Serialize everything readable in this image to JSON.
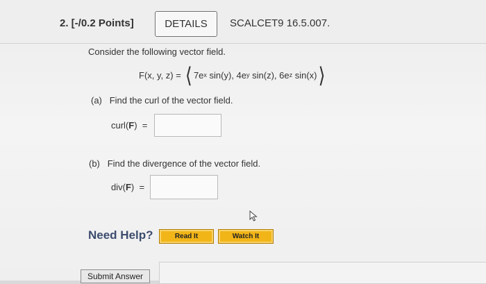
{
  "question": {
    "number_points": "2.  [-/0.2 Points]",
    "details_label": "DETAILS",
    "course_code": "SCALCET9 16.5.007."
  },
  "problem": {
    "intro": "Consider the following vector field.",
    "formula": {
      "lhs": "F(x, y, z) =",
      "c1_coef": "7e",
      "c1_exp": "x",
      "c1_rest": " sin(y), ",
      "c2_coef": "4e",
      "c2_exp": "y",
      "c2_rest": " sin(z), ",
      "c3_coef": "6e",
      "c3_exp": "z",
      "c3_rest": " sin(x)",
      "open": "⟨",
      "close": "⟩"
    },
    "part_a": "(a)   Find the curl of the vector field.",
    "curl_label_pre": "curl(",
    "curl_label_F": "F",
    "curl_label_post": ")  =",
    "part_b": "(b)   Find the divergence of the vector field.",
    "div_label_pre": "div(",
    "div_label_F": "F",
    "div_label_post": ")  ="
  },
  "help": {
    "label": "Need Help?",
    "read_it": "Read It",
    "watch_it": "Watch It"
  },
  "submit_label": "Submit Answer",
  "colors": {
    "help_button": "#f2b518",
    "need_help_text": "#3c4c6e"
  },
  "icons": {
    "cursor": "mouse-pointer-icon"
  }
}
